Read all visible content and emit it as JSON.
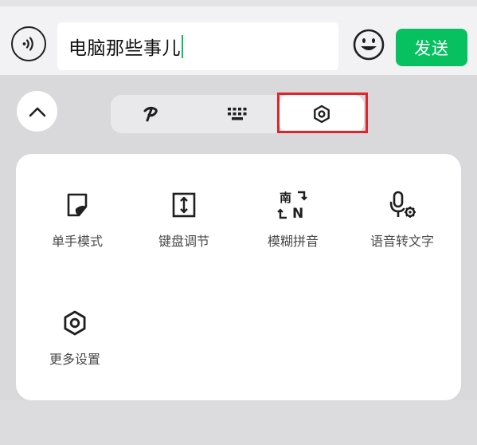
{
  "input_bar": {
    "text_value": "电脑那些事儿",
    "send_label": "发送",
    "icons": [
      "voice-icon",
      "emoji-icon"
    ],
    "accent_color": "#07c160"
  },
  "keyboard_tabs": {
    "items": [
      "handwriting-icon",
      "keyboard-icon",
      "settings-hex-icon"
    ],
    "selected_index": 2,
    "highlight_color": "#e0242b"
  },
  "toolbar": {
    "collapse_icon": "chevron-up-icon"
  },
  "tools": [
    {
      "label": "单手模式",
      "icon": "one-hand-icon"
    },
    {
      "label": "键盘调节",
      "icon": "resize-icon"
    },
    {
      "label": "模糊拼音",
      "icon": "fuzzy-pinyin-icon",
      "icon_text_top": "南",
      "icon_text_bottom": "N"
    },
    {
      "label": "语音转文字",
      "icon": "mic-settings-icon"
    },
    {
      "label": "更多设置",
      "icon": "settings-hex-icon"
    }
  ]
}
